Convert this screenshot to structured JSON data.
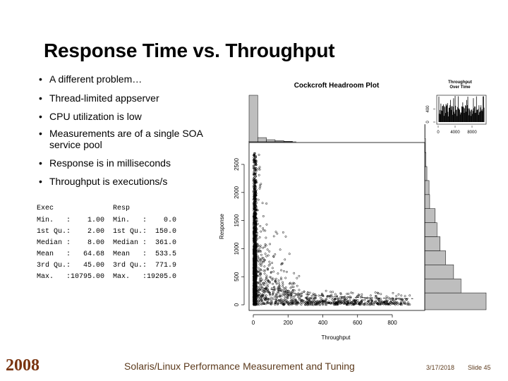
{
  "slide": {
    "title": "Response Time vs. Throughput",
    "bullets": [
      "A different problem…",
      "Thread-limited appserver",
      "CPU utilization is low",
      "Measurements are of a single SOA",
      "service pool",
      "Response is in milliseconds",
      "Throughput is executions/s"
    ],
    "bullet_marker": "•"
  },
  "summary": {
    "headers": [
      "Exec",
      "Resp"
    ],
    "rows": [
      {
        "label": "Min.   :",
        "exec": "1.00",
        "label2": "Min.   :",
        "resp": "0.0"
      },
      {
        "label": "1st Qu.:",
        "exec": "2.00",
        "label2": "1st Qu.:",
        "resp": "150.0"
      },
      {
        "label": "Median :",
        "exec": "8.00",
        "label2": "Median :",
        "resp": "361.0"
      },
      {
        "label": "Mean   :",
        "exec": "64.68",
        "label2": "Mean   :",
        "resp": "533.5"
      },
      {
        "label": "3rd Qu.:",
        "exec": "45.00",
        "label2": "3rd Qu.:",
        "resp": "771.9"
      },
      {
        "label": "Max.   :",
        "exec": "10795.00",
        "label2": "Max.   :",
        "resp": "19205.0"
      }
    ]
  },
  "footer": {
    "year": "2008",
    "center": "Solaris/Linux Performance Measurement and Tuning",
    "date": "3/17/2018",
    "slide": "Slide 45"
  },
  "chart_data": [
    {
      "type": "scatter",
      "title": "Cockcroft Headroom Plot",
      "xlabel": "Throughput",
      "ylabel": "Response",
      "xlim": [
        0,
        950
      ],
      "ylim": [
        0,
        2700
      ],
      "xticks": [
        "0",
        "200",
        "400",
        "600",
        "800"
      ],
      "yticks": [
        "0",
        "500",
        "1000",
        "1500",
        "2000",
        "2500"
      ],
      "grid": false,
      "reference_curve": {
        "x": [
          60,
          200,
          400,
          600,
          800,
          920
        ],
        "y": [
          300,
          220,
          160,
          130,
          115,
          110
        ]
      },
      "throughput_histogram": {
        "bin_width": 50,
        "counts_relative": [
          1.0,
          0.09,
          0.045,
          0.025,
          0.01
        ]
      },
      "response_histogram": {
        "bin_width": 250,
        "counts_relative": [
          1.0,
          0.59,
          0.47,
          0.34,
          0.25,
          0.2,
          0.17,
          0.08,
          0.07,
          0.035,
          0.02,
          0.012,
          0.006
        ]
      }
    },
    {
      "type": "bar",
      "title": "Throughput Over Time",
      "xticks": [
        "0",
        "4000",
        "8000"
      ],
      "yticks": [
        "0",
        "400"
      ],
      "xlim": [
        0,
        9000
      ],
      "ylim": [
        0,
        800
      ]
    }
  ]
}
